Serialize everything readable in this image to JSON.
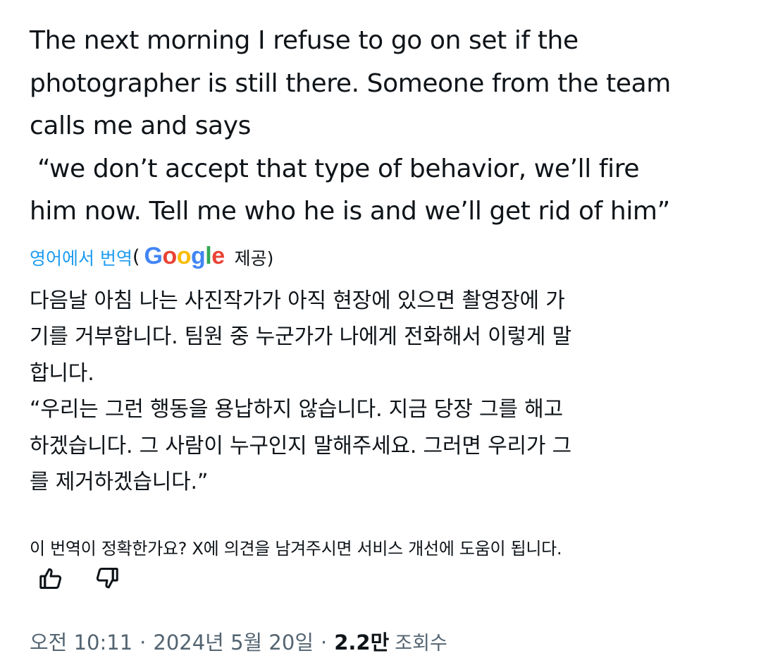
{
  "tweet": {
    "original_lines": [
      "The next morning I refuse to go on set if the",
      "photographer is still there. Someone from the team",
      "calls me and says",
      " “we don’t accept that type of behavior, we’ll fire",
      "him now. Tell me who he is and we’ll get rid of him”"
    ],
    "translate_link": "영어에서 번역",
    "paren_open": "(",
    "provider_logo": {
      "letters": [
        "G",
        "o",
        "o",
        "g",
        "l",
        "e"
      ],
      "colors": [
        "#4285f4",
        "#ea4335",
        "#fbbc05",
        "#4285f4",
        "#34a853",
        "#ea4335"
      ]
    },
    "provider_suffix": "제공)",
    "translated_lines": [
      "다음날 아침 나는 사진작가가 아직 현장에 있으면 촬영장에 가",
      "기를 거부합니다. 팀원 중 누군가가 나에게 전화해서 이렇게 말",
      "합니다.",
      "“우리는 그런 행동을 용납하지 않습니다. 지금 당장 그를 해고",
      "하겠습니다. 그 사람이 누구인지 말해주세요. 그러면 우리가 그",
      "를 제거하겠습니다.”"
    ]
  },
  "feedback": {
    "question": "이 번역이 정확한가요? X에 의견을 남겨주시면 서비스 개선에 도움이 됩니다.",
    "thumbs_up_icon": "thumbs-up-icon",
    "thumbs_down_icon": "thumbs-down-icon"
  },
  "meta": {
    "time": "오전 10:11",
    "separator": "·",
    "date": "2024년 5월 20일",
    "views_count": "2.2만",
    "views_label": "조회수"
  },
  "colors": {
    "text": "#0f1419",
    "link": "#1d9bf0",
    "secondary": "#536471"
  }
}
